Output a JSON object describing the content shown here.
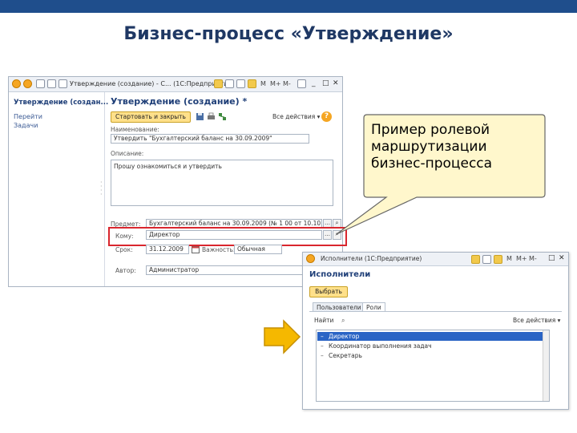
{
  "slide": {
    "title": "Бизнес-процесс «Утверждение»"
  },
  "window1": {
    "title": "Утверждение (создание) - С... (1С:Предприятие)",
    "menu_m": "M",
    "menu_mplus": "M+",
    "menu_mminus": "M-",
    "sidebar": {
      "header": "Утверждение (создан...",
      "items": [
        "Перейти",
        "Задачи"
      ]
    },
    "form": {
      "title": "Утверждение (создание) *",
      "start_close_button": "Стартовать и закрыть",
      "all_actions": "Все действия ▾",
      "help": "?",
      "name_label": "Наименование:",
      "name_value": "Утвердить \"Бухгалтерский баланс на 30.09.2009\"",
      "description_label": "Описание:",
      "description_value": "Прошу ознакомиться и утвердить",
      "subject_label": "Предмет:",
      "subject_value": "Бухгалтерский баланс на 30.09.2009 (№ 1 00 от 10.10.2009)",
      "whom_label": "Кому:",
      "whom_value": "Директор",
      "deadline_label": "Срок:",
      "deadline_value": "31.12.2009",
      "importance_label": "Важность:",
      "importance_value": "Обычная",
      "author_label": "Автор:",
      "author_value": "Администратор"
    }
  },
  "callout": {
    "line1": "Пример ролевой",
    "line2": "маршрутизации",
    "line3": "бизнес-процесса"
  },
  "window2": {
    "title": "Исполнители (1С:Предприятие)",
    "header": "Исполнители",
    "select_button": "Выбрать",
    "tabs": [
      "Пользователи",
      "Роли"
    ],
    "find_button": "Найти",
    "all_actions": "Все действия ▾",
    "rows": [
      "Директор",
      "Координатор выполнения задач",
      "Секретарь"
    ]
  },
  "colors": {
    "accent_bar": "#1f4e8c",
    "title_text": "#1f3864",
    "highlight_border": "#d9262e",
    "callout_fill": "#fff7cc",
    "arrow_fill": "#f5b800",
    "selected_row": "#2a64c5"
  }
}
